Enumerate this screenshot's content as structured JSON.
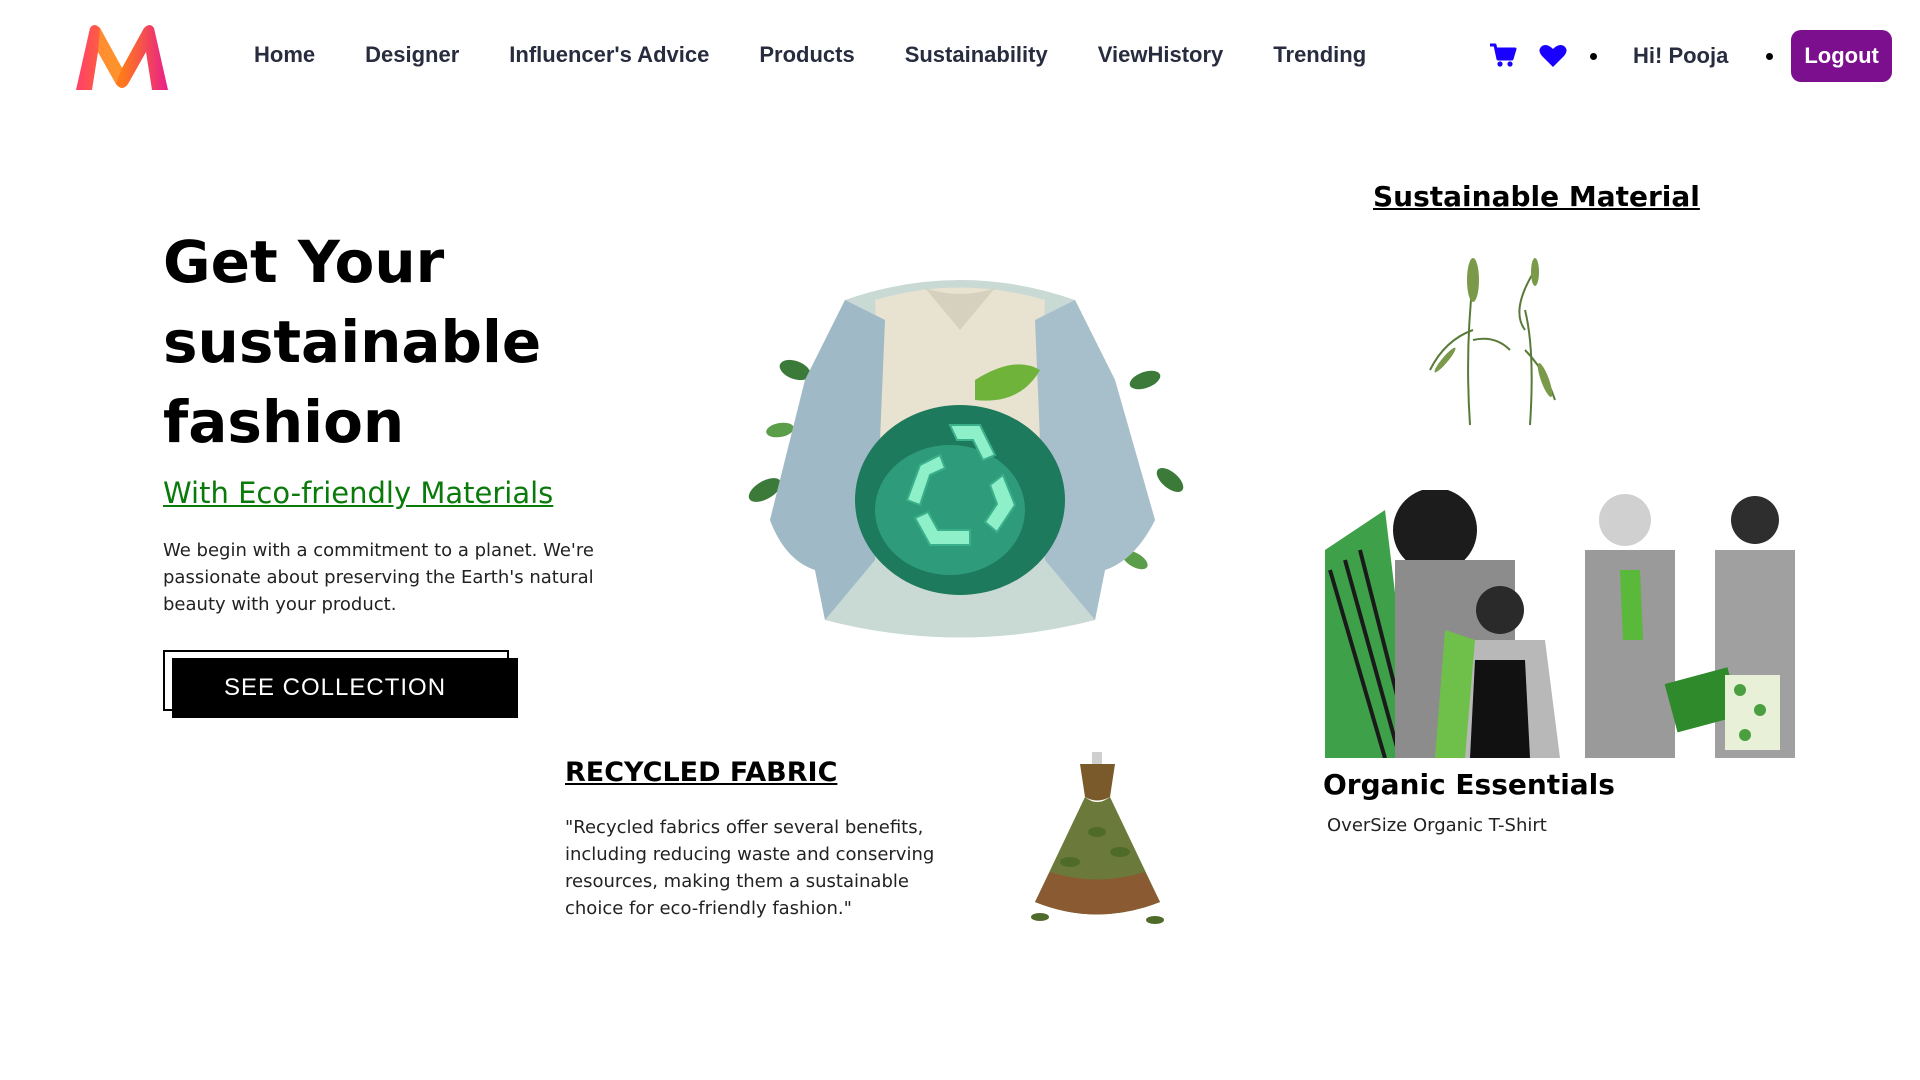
{
  "nav": {
    "links": [
      "Home",
      "Designer",
      "Influencer's Advice",
      "Products",
      "Sustainability",
      "ViewHistory",
      "Trending"
    ],
    "greeting": "Hi! Pooja",
    "logout_label": "Logout",
    "icons": [
      "cart-icon",
      "heart-icon"
    ],
    "accent_color": "#7b0f8e",
    "icon_color": "#1a00ff"
  },
  "hero": {
    "title": "Get Your sustainable fashion",
    "subtitle": "With Eco-friendly Materials",
    "description": "We begin with a commitment to a planet. We're passionate about preserving the Earth's natural beauty with your product.",
    "cta_label": "SEE COLLECTION",
    "subtitle_color": "#0a7a0a"
  },
  "recycled": {
    "title": "RECYCLED FABRIC",
    "description": "\"Recycled fabrics offer several benefits, including reducing waste and conserving resources, making them a sustainable choice for eco-friendly fashion.\""
  },
  "sustainable": {
    "title": "Sustainable Material"
  },
  "organic": {
    "title": "Organic Essentials",
    "subtitle": "OverSize Organic T-Shirt"
  }
}
